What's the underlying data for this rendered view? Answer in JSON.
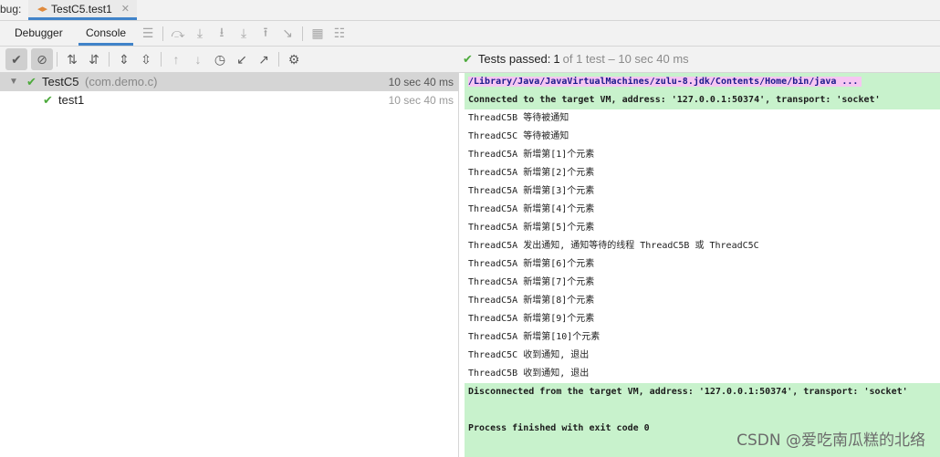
{
  "tabbar": {
    "debug_label": "bug:",
    "run_tab": "TestC5.test1"
  },
  "toolbar1": {
    "tab_debugger": "Debugger",
    "tab_console": "Console"
  },
  "status": {
    "prefix": "Tests passed:",
    "count": "1",
    "rest": "of 1 test – 10 sec 40 ms"
  },
  "tree": {
    "root": {
      "name": "TestC5",
      "pkg": "(com.demo.c)",
      "time": "10 sec 40 ms"
    },
    "child": {
      "name": "test1",
      "time": "10 sec 40 ms"
    }
  },
  "console": {
    "path": "/Library/Java/JavaVirtualMachines/zulu-8.jdk/Contents/Home/bin/java ...",
    "connected": "Connected to the target VM, address: '127.0.0.1:50374', transport: 'socket'",
    "lines": [
      "ThreadC5B 等待被通知",
      "ThreadC5C 等待被通知",
      "ThreadC5A 新增第[1]个元素",
      "ThreadC5A 新增第[2]个元素",
      "ThreadC5A 新增第[3]个元素",
      "ThreadC5A 新增第[4]个元素",
      "ThreadC5A 新增第[5]个元素",
      "ThreadC5A 发出通知, 通知等待的线程 ThreadC5B 或 ThreadC5C",
      "ThreadC5A 新增第[6]个元素",
      "ThreadC5A 新增第[7]个元素",
      "ThreadC5A 新增第[8]个元素",
      "ThreadC5A 新增第[9]个元素",
      "ThreadC5A 新增第[10]个元素",
      "ThreadC5C 收到通知, 退出",
      "ThreadC5B 收到通知, 退出"
    ],
    "disconnected": "Disconnected from the target VM, address: '127.0.0.1:50374', transport: 'socket'",
    "finished": "Process finished with exit code 0"
  },
  "watermark": "CSDN @爱吃南瓜糕的北络",
  "colors": {
    "accent": "#4083c9",
    "pass": "#4daa3c",
    "console_green": "#c8f2cc",
    "path_pink": "#f6c6f2"
  }
}
